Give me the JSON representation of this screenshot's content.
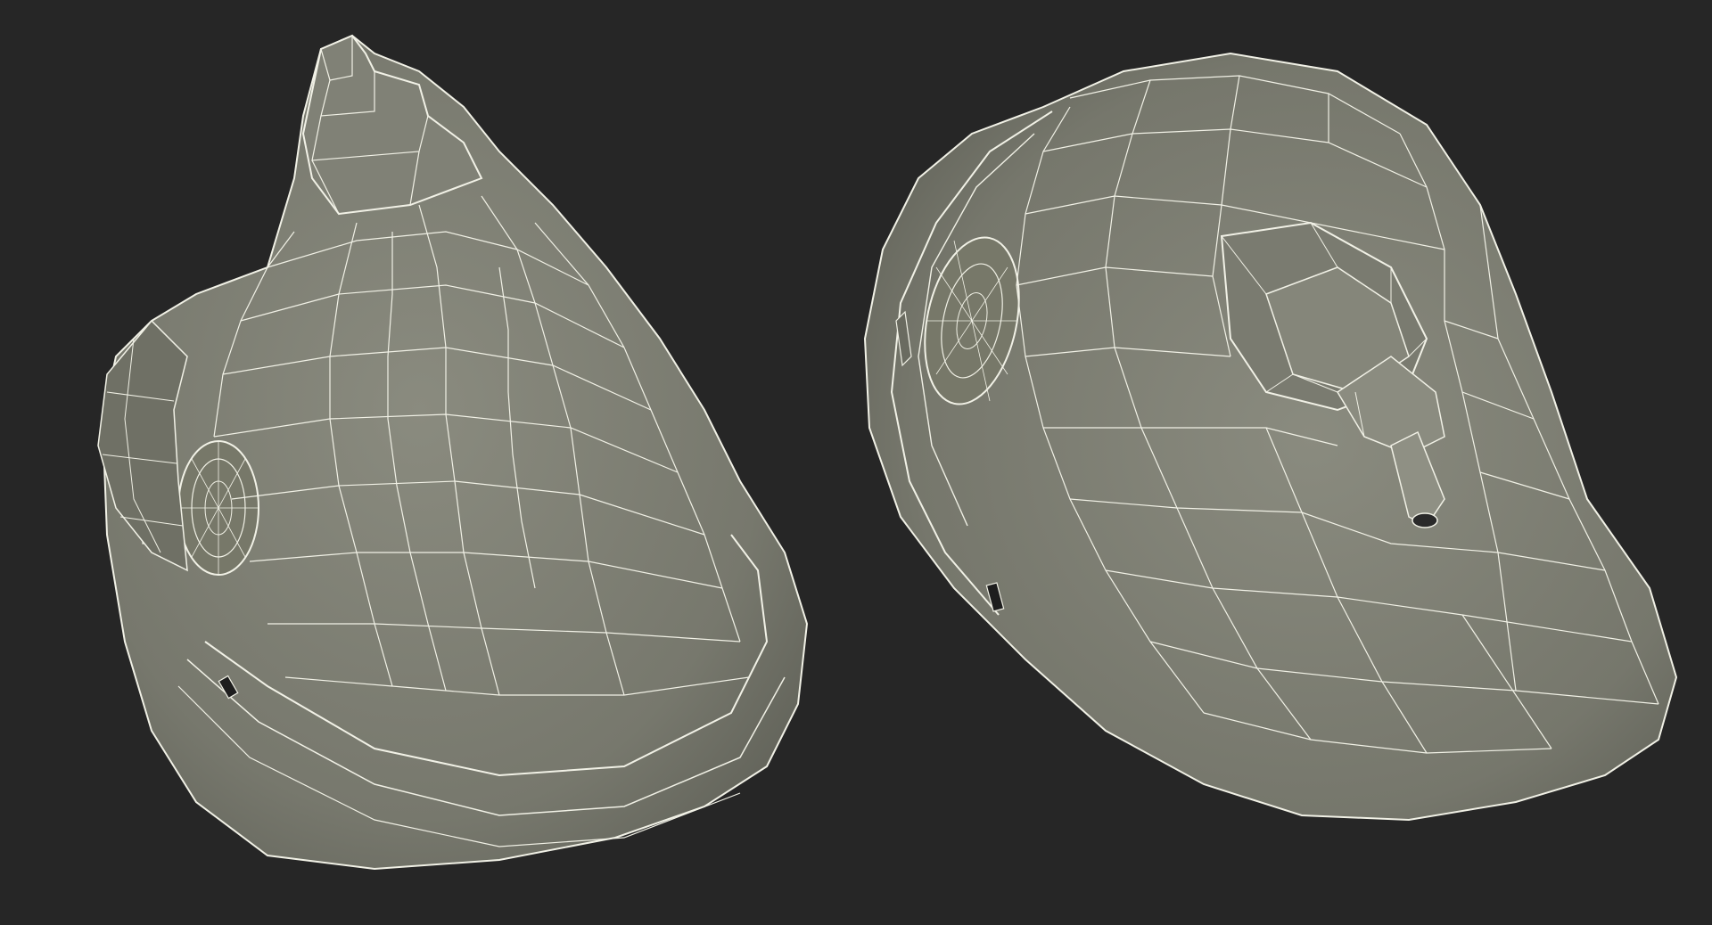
{
  "scene": {
    "background_color": "#262626",
    "mesh_fill_color": "#7c7d71",
    "mesh_shadow_color": "#5d5e55",
    "mesh_highlight_color": "#95968a",
    "wire_color": "#f1f1e6",
    "models": [
      {
        "view": "top",
        "subject": "mask-shell-wireframe"
      },
      {
        "view": "angled",
        "subject": "mask-shell-wireframe-with-connector"
      }
    ]
  }
}
